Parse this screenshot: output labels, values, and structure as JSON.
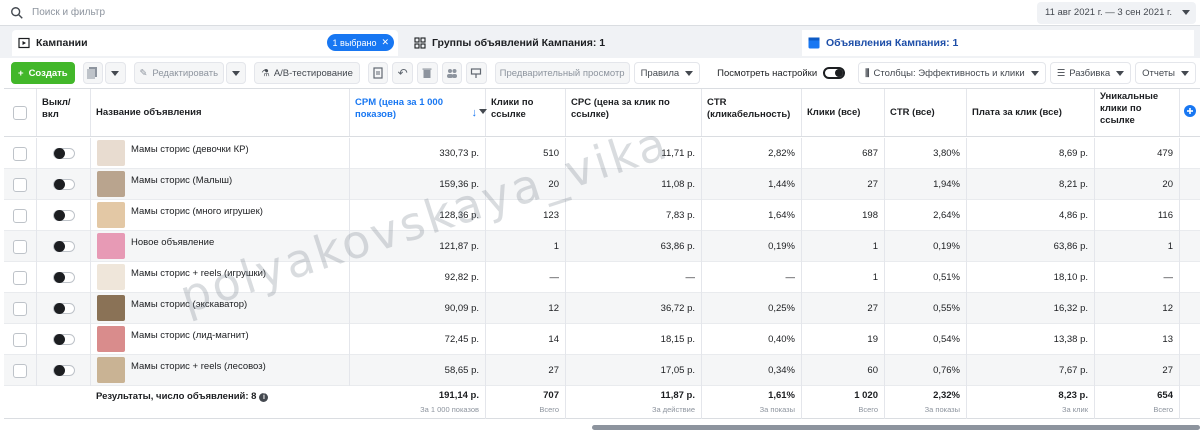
{
  "search": {
    "placeholder": "Поиск и фильтр"
  },
  "date_range": "11 авг 2021 г. — 3 сен 2021 г.",
  "tabs": {
    "campaigns": "Кампании",
    "selected_badge": "1 выбрано",
    "adsets": "Группы объявлений Кампания: 1",
    "ads": "Объявления Кампания: 1"
  },
  "toolbar": {
    "create": "Создать",
    "edit": "Редактировать",
    "ab_test": "A/B-тестирование",
    "preview": "Предварительный просмотр",
    "rules": "Правила",
    "view_settings": "Посмотреть настройки",
    "columns": "Столбцы: Эффективность и клики",
    "breakdown": "Разбивка",
    "reports": "Отчеты"
  },
  "columns": {
    "toggle": "Выкл/ вкл",
    "name": "Название объявления",
    "cpm": "CPM (цена за 1 000 показов)",
    "link_clicks": "Клики по ссылке",
    "cpc": "CPC (цена за клик по ссылке)",
    "ctr": "CTR (кликабельность)",
    "clicks_all": "Клики (все)",
    "ctr_all": "CTR (все)",
    "cost_per_click": "Плата за клик (все)",
    "unique_clicks": "Уникальные клики по ссылке"
  },
  "rows": [
    {
      "name": "Мамы сторис (девочки КР)",
      "cpm": "330,73 р.",
      "link_clicks": "510",
      "cpc": "11,71 р.",
      "ctr": "2,82%",
      "clicks_all": "687",
      "ctr_all": "3,80%",
      "cost_per_click": "8,69 р.",
      "unique_clicks": "479",
      "thumb_color": "#e8dcd0"
    },
    {
      "name": "Мамы сторис (Малыш)",
      "cpm": "159,36 р.",
      "link_clicks": "20",
      "cpc": "11,08 р.",
      "ctr": "1,44%",
      "clicks_all": "27",
      "ctr_all": "1,94%",
      "cost_per_click": "8,21 р.",
      "unique_clicks": "20",
      "thumb_color": "#b9a48e"
    },
    {
      "name": "Мамы сторис (много игрушек)",
      "cpm": "128,36 р.",
      "link_clicks": "123",
      "cpc": "7,83 р.",
      "ctr": "1,64%",
      "clicks_all": "198",
      "ctr_all": "2,64%",
      "cost_per_click": "4,86 р.",
      "unique_clicks": "116",
      "thumb_color": "#e3c8a5"
    },
    {
      "name": "Новое объявление",
      "cpm": "121,87 р.",
      "link_clicks": "1",
      "cpc": "63,86 р.",
      "ctr": "0,19%",
      "clicks_all": "1",
      "ctr_all": "0,19%",
      "cost_per_click": "63,86 р.",
      "unique_clicks": "1",
      "thumb_color": "#e79ab5"
    },
    {
      "name": "Мамы сторис + reels (игрушки)",
      "cpm": "92,82 р.",
      "link_clicks": "—",
      "cpc": "—",
      "ctr": "—",
      "clicks_all": "1",
      "ctr_all": "0,51%",
      "cost_per_click": "18,10 р.",
      "unique_clicks": "—",
      "thumb_color": "#efe6da"
    },
    {
      "name": "Мамы сторис (экскаватор)",
      "cpm": "90,09 р.",
      "link_clicks": "12",
      "cpc": "36,72 р.",
      "ctr": "0,25%",
      "clicks_all": "27",
      "ctr_all": "0,55%",
      "cost_per_click": "16,32 р.",
      "unique_clicks": "12",
      "thumb_color": "#8a7256"
    },
    {
      "name": "Мамы сторис (лид-магнит)",
      "cpm": "72,45 р.",
      "link_clicks": "14",
      "cpc": "18,15 р.",
      "ctr": "0,40%",
      "clicks_all": "19",
      "ctr_all": "0,54%",
      "cost_per_click": "13,38 р.",
      "unique_clicks": "13",
      "thumb_color": "#d98c8c"
    },
    {
      "name": "Мамы сторис + reels (лесовоз)",
      "cpm": "58,65 р.",
      "link_clicks": "27",
      "cpc": "17,05 р.",
      "ctr": "0,34%",
      "clicks_all": "60",
      "ctr_all": "0,76%",
      "cost_per_click": "7,67 р.",
      "unique_clicks": "27",
      "thumb_color": "#c9b394"
    }
  ],
  "totals": {
    "label": "Результаты, число объявлений: 8",
    "cpm": "191,14 р.",
    "cpm_sub": "За 1 000 показов",
    "link_clicks": "707",
    "link_clicks_sub": "Всего",
    "cpc": "11,87 р.",
    "cpc_sub": "За действие",
    "ctr": "1,61%",
    "ctr_sub": "За показы",
    "clicks_all": "1 020",
    "clicks_all_sub": "Всего",
    "ctr_all": "2,32%",
    "ctr_all_sub": "За показы",
    "cost_per_click": "8,23 р.",
    "cost_per_click_sub": "За клик",
    "unique_clicks": "654",
    "unique_clicks_sub": "Всего"
  },
  "watermark": "polyakovskaya_vika"
}
